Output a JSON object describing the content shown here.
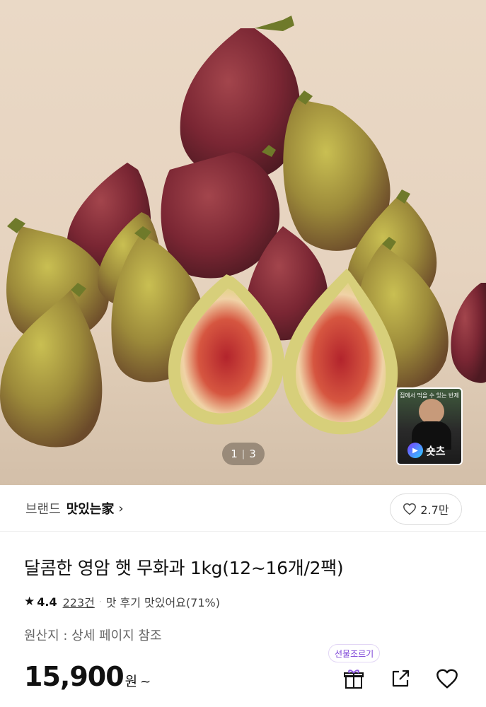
{
  "hero": {
    "pager": {
      "current": "1",
      "separator": "|",
      "total": "3"
    },
    "shorts": {
      "caption": "집에서 먹을 수 있는 반제품",
      "label": "숏츠"
    }
  },
  "brand": {
    "label": "브랜드",
    "name": "맛있는家",
    "chevron": "›"
  },
  "likes": {
    "count": "2.7만"
  },
  "product": {
    "title": "달콤한 영암 햇 무화과 1kg(12~16개/2팩)",
    "rating": {
      "star": "★",
      "score": "4.4",
      "review_count": "223건",
      "dot": "·",
      "taste_summary": "맛 후기 맛있어요(71%)"
    },
    "origin": "원산지 : 상세 페이지 참조",
    "price": {
      "amount": "15,900",
      "unit": "원",
      "suffix": "~"
    }
  },
  "actions": {
    "gift_tooltip": "선물조르기"
  },
  "colors": {
    "gift_purple": "#7a3fd6",
    "text_primary": "#111111",
    "text_secondary": "#666666"
  }
}
